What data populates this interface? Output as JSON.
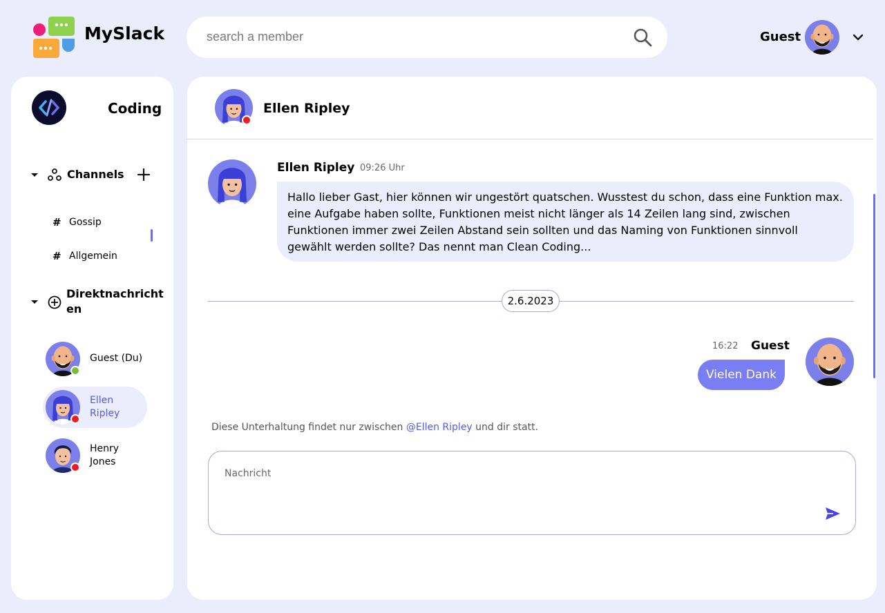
{
  "app": {
    "brand": "MySlack"
  },
  "search": {
    "placeholder": "search a member"
  },
  "user": {
    "name": "Guest"
  },
  "workspace": {
    "name": "Coding"
  },
  "channels": {
    "title": "Channels",
    "items": [
      {
        "label": "Gossip"
      },
      {
        "label": "Allgemein"
      }
    ]
  },
  "direct": {
    "title_line1": "Direktnachricht",
    "title_line2": "en",
    "items": [
      {
        "line1": "Guest (Du)",
        "line2": "",
        "status_color": "#7cbb3c"
      },
      {
        "line1": "Ellen",
        "line2": "Ripley",
        "status_color": "#ed1c24"
      },
      {
        "line1": "Henry",
        "line2": "Jones",
        "status_color": "#ed1c24"
      }
    ]
  },
  "chat": {
    "header_name": "Ellen Ripley",
    "messages": [
      {
        "sender": "Ellen Ripley",
        "time": "09:26 Uhr",
        "text": "Hallo lieber Gast, hier können wir ungestört quatschen. Wusstest du schon, dass eine Funktion max. eine Aufgabe haben sollte, Funktionen meist nicht länger als 14 Zeilen lang sind, zwischen Funktionen immer zwei Zeilen Abstand sein sollten und das Naming von Funktionen sinnvoll gewählt werden sollte? Das nennt man Clean Coding..."
      },
      {
        "sender": "Guest",
        "time": "16:22",
        "text": "Vielen Dank"
      }
    ],
    "date_separator": "2.6.2023",
    "note_before": "Diese Unterhaltung findet nur zwischen ",
    "note_mention": "@Ellen Ripley",
    "note_after": " und dir statt.",
    "composer_placeholder": "Nachricht"
  },
  "colors": {
    "accent": "#797ef3",
    "mention": "#535af1",
    "background": "#ecedfc",
    "status_online": "#7cbb3c",
    "status_busy": "#ed1c24"
  }
}
